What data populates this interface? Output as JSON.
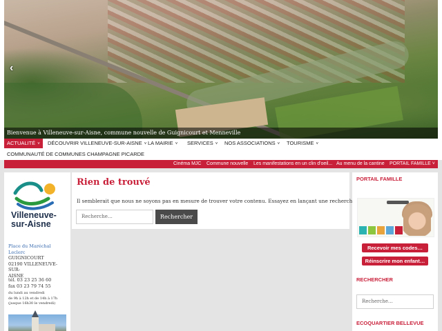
{
  "slider": {
    "caption": "Bienvenue à Villeneuve-sur-Aisne, commune nouvelle de Guignicourt et Menneville",
    "prev_icon": "chevron-left-icon",
    "next_icon": "chevron-right-icon",
    "prev_glyph": "‹",
    "next_glyph": "›"
  },
  "nav": {
    "items": [
      {
        "label": "ACTUALITÉ"
      },
      {
        "label": "DÉCOUVRIR VILLENEUVE-SUR-AISNE"
      },
      {
        "label": "LA MAIRIE"
      },
      {
        "label": "SERVICES"
      },
      {
        "label": "NOS ASSOCIATIONS"
      },
      {
        "label": "TOURISME"
      }
    ],
    "second_row": "COMMUNAUTÉ DE COMMUNES CHAMPAGNE PICARDE",
    "chevron": "˅"
  },
  "quicklinks": [
    {
      "label": "Cinéma MJC"
    },
    {
      "label": "Commune nouvelle"
    },
    {
      "label": "Les manifestations en un clin d'oeil..."
    },
    {
      "label": "Au menu de la cantine"
    },
    {
      "label": "PORTAIL FAMILLE"
    }
  ],
  "sidebar_left": {
    "logo_text_line1": "Villeneuve-",
    "logo_text_line2": "sur-Aisne",
    "address_line1": "Place du Maréchal",
    "address_line2": "Leclerc",
    "address_line3": "GUIGNICOURT",
    "address_line4": "02190 VILLENEUVE-SUR-",
    "address_line5": "AISNE",
    "tel": "tél. 03 23 25 36 60",
    "fax": "fax 03 23 79 74 55",
    "hours_line1": "du lundi au vendredi",
    "hours_line2": "de 9h à 12h et de 14h à 17h",
    "hours_line3": "(jusque 16h30 le vendredi)"
  },
  "main": {
    "title": "Rien de trouvé",
    "message": "Il semblerait que nous ne soyons pas en mesure de trouver votre contenu. Essayez en lançant une recherche.",
    "search_placeholder": "Recherche…",
    "search_button": "Rechercher"
  },
  "sidebar_right": {
    "portail_title": "PORTAIL FAMILLE",
    "codes_button": "Recevoir mes codes…",
    "reinscrire_button": "Réinscrire mon enfant…",
    "search_title": "RECHERCHER",
    "search_placeholder": "Recherche…",
    "ecoquartier_title": "ECOQUARTIER BELLEVUE"
  },
  "colors": {
    "accent": "#c9203a",
    "button_dark": "#4a4a4a",
    "background": "#e4e4e4"
  }
}
